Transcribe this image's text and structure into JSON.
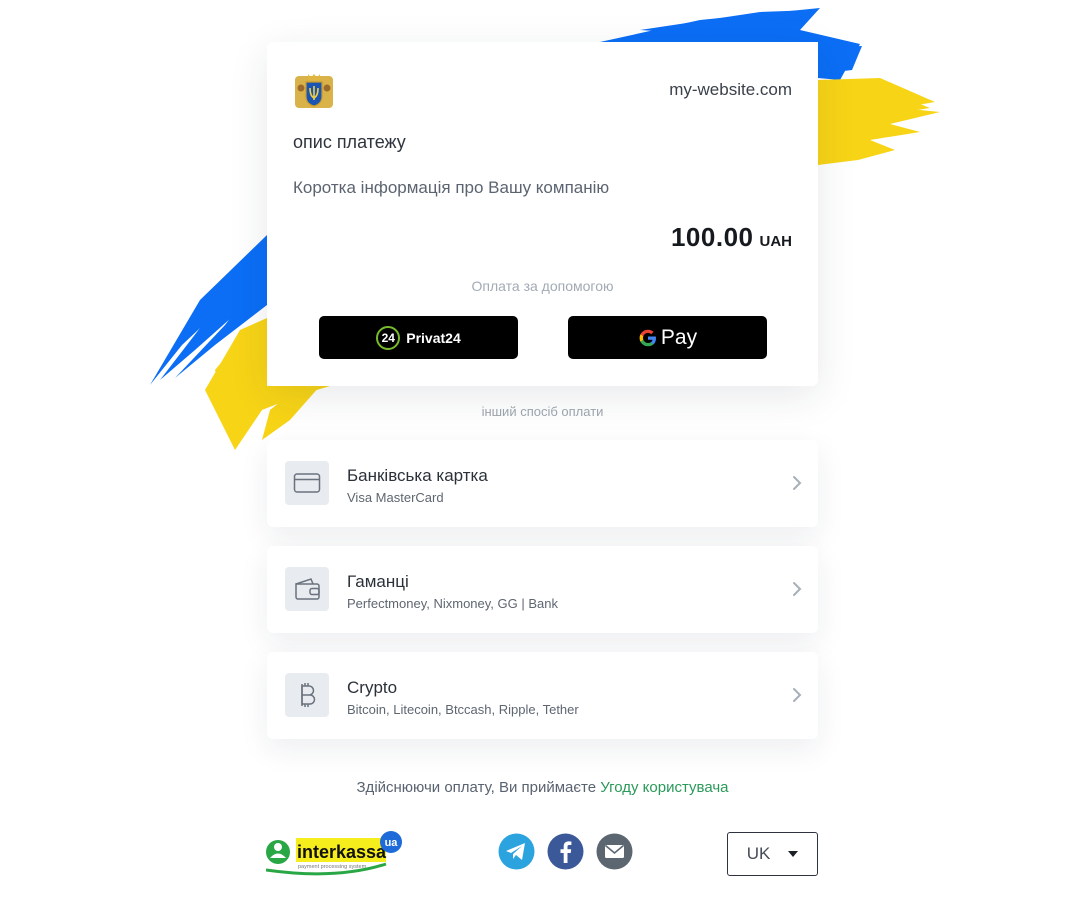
{
  "colors": {
    "accent_green": "#2a9a5a",
    "flag_blue": "#0b6ef5",
    "flag_yellow": "#f7d416",
    "button_black": "#000000"
  },
  "merchant": {
    "logo_icon": "coat-of-arms",
    "site": "my-website.com",
    "description": "опис платежу",
    "company_info": "Коротка інформація про Вашу компанію"
  },
  "payment": {
    "amount": "100.00",
    "currency": "UAH"
  },
  "quick_pay": {
    "label": "Оплата за допомогою",
    "privat_badge": "24",
    "privat_label": "Privat24",
    "gpay_label": "Pay"
  },
  "other_methods_label": "інший спосіб оплати",
  "methods": [
    {
      "title": "Банківська картка",
      "subtitle": "Visa MasterCard",
      "icon": "credit-card-icon"
    },
    {
      "title": "Гаманці",
      "subtitle": "Perfectmoney, Nixmoney, GG | Bank",
      "icon": "wallet-icon"
    },
    {
      "title": "Crypto",
      "subtitle": "Bitcoin, Litecoin, Btccash, Ripple, Tether",
      "icon": "bitcoin-icon"
    }
  ],
  "agreement": {
    "text": "Здійснюючи оплату, Ви приймаєте",
    "link": "Угоду користувача"
  },
  "footer": {
    "brand": "interkassa",
    "brand_badge": "ua",
    "brand_tagline": "payment processing system",
    "language": "UK",
    "socials": [
      "telegram-icon",
      "facebook-icon",
      "email-icon"
    ]
  }
}
